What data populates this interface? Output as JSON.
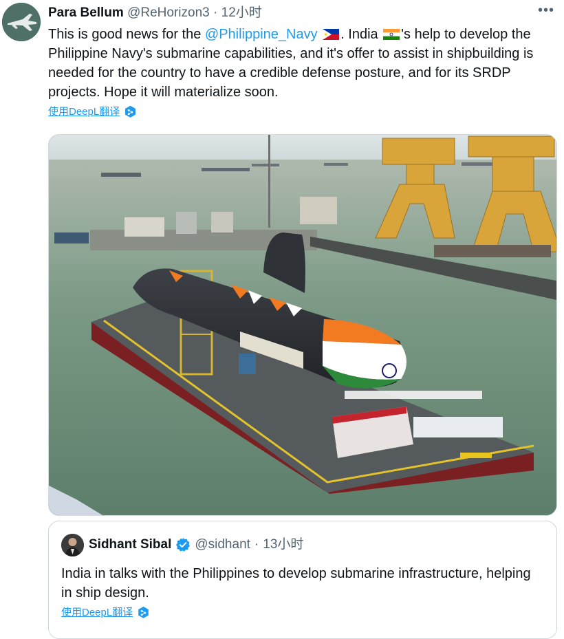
{
  "tweet": {
    "display_name": "Para Bellum",
    "handle": "@ReHorizon3",
    "separator": "·",
    "time": "12小时",
    "more_icon": "more-horizontal-icon",
    "text_1": "This is good news for the ",
    "mention": "@Philippine_Navy",
    "text_2": ". India ",
    "text_3": "'s help to develop the Philippine Navy's submarine capabilities, and it's offer to assist in shipbuilding is needed for the country to have a credible defense posture, and for its SRDP projects. Hope it will materialize soon.",
    "flags": [
      "philippines-flag-icon",
      "india-flag-icon"
    ],
    "translate_label": "使用DeepL翻译",
    "translate_icon": "deepl-icon"
  },
  "media": {
    "description_icon": "submarine-launch-photo"
  },
  "quote": {
    "display_name": "Sidhant Sibal",
    "verified_icon": "verified-badge-icon",
    "handle": "@sidhant",
    "separator": "·",
    "time": "13小时",
    "text": "India in talks with the Philippines to develop submarine infrastructure, helping in ship design.",
    "translate_label": "使用DeepL翻译"
  },
  "colors": {
    "link": "#1d9bf0",
    "text": "#0f1419",
    "muted": "#536471",
    "border": "#cfd9de"
  }
}
